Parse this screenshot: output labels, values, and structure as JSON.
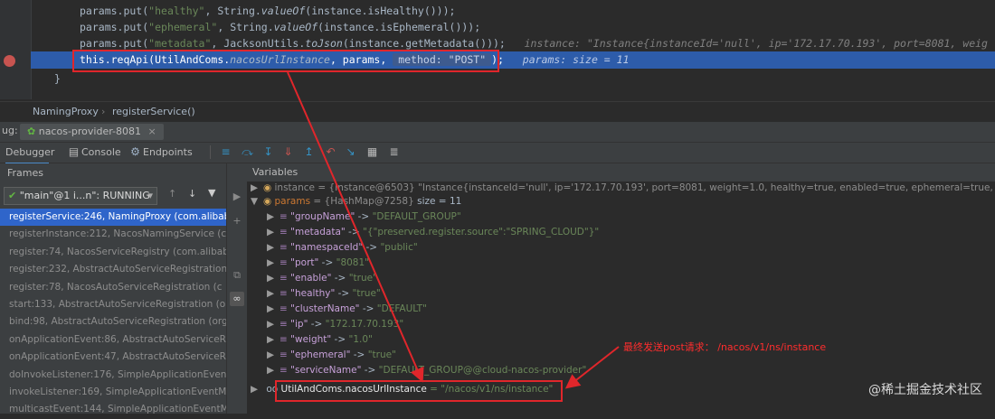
{
  "editor": {
    "lines": [
      {
        "pre": "params.put(",
        "key": "\"healthy\"",
        "mid": ", String.",
        "fn": "valueOf",
        "post": "(instance.isHealthy()));"
      },
      {
        "pre": "params.put(",
        "key": "\"ephemeral\"",
        "mid": ", String.",
        "fn": "valueOf",
        "post": "(instance.isEphemeral()));"
      },
      {
        "pre": "params.put(",
        "key": "\"metadata\"",
        "mid": ", JacksonUtils.",
        "fn": "toJson",
        "post": "(instance.getMetadata()));",
        "inline": "instance: \"Instance{instanceId='null', ip='172.17.70.193', port=8081, weig"
      }
    ],
    "highlight": {
      "code": "this.reqApi(UtilAndComs.",
      "field": "nacosUrlInstance",
      "rest": ", params,",
      "hint_label": "method:",
      "hint_value": "\"POST\"",
      "close": ");",
      "inline": "params:  size = 11"
    },
    "closing_brace": "}"
  },
  "breadcrumb": {
    "class_name": "NamingProxy",
    "method": "registerService()"
  },
  "debug": {
    "label": "ug:",
    "run_tab": "nacos-provider-8081",
    "tabs": {
      "debugger": "Debugger",
      "console": "Console",
      "endpoints": "Endpoints"
    }
  },
  "frames": {
    "header": "Frames",
    "thread": "\"main\"@1 i...n\": RUNNING",
    "items": [
      "registerService:246, NamingProxy (com.alibaba",
      "registerInstance:212, NacosNamingService (c",
      "register:74, NacosServiceRegistry (com.alibaba",
      "register:232, AbstractAutoServiceRegistration",
      "register:78, NacosAutoServiceRegistration (c",
      "start:133, AbstractAutoServiceRegistration (or",
      "bind:98, AbstractAutoServiceRegistration (org",
      "onApplicationEvent:86, AbstractAutoServiceRe",
      "onApplicationEvent:47, AbstractAutoServiceRe",
      "doInvokeListener:176, SimpleApplicationEvent",
      "invokeListener:169, SimpleApplicationEventMu",
      "multicastEvent:144, SimpleApplicationEventMu"
    ]
  },
  "variables": {
    "header": "Variables",
    "instance_row": "instance = {Instance@6503} \"Instance{instanceId='null', ip='172.17.70.193', port=8081, weight=1.0, healthy=true, enabled=true, ephemeral=true, clusterNa",
    "params": {
      "name": "params",
      "type": "= {HashMap@7258}",
      "size": "size = 11"
    },
    "entries": [
      {
        "key": "\"groupName\"",
        "value": "\"DEFAULT_GROUP\""
      },
      {
        "key": "\"metadata\"",
        "value": "\"{\"preserved.register.source\":\"SPRING_CLOUD\"}\""
      },
      {
        "key": "\"namespaceId\"",
        "value": "\"public\""
      },
      {
        "key": "\"port\"",
        "value": "\"8081\""
      },
      {
        "key": "\"enable\"",
        "value": "\"true\""
      },
      {
        "key": "\"healthy\"",
        "value": "\"true\""
      },
      {
        "key": "\"clusterName\"",
        "value": "\"DEFAULT\""
      },
      {
        "key": "\"ip\"",
        "value": "\"172.17.70.193\""
      },
      {
        "key": "\"weight\"",
        "value": "\"1.0\""
      },
      {
        "key": "\"ephemeral\"",
        "value": "\"true\""
      },
      {
        "key": "\"serviceName\"",
        "value": "\"DEFAULT_GROUP@@cloud-nacos-provider\""
      }
    ],
    "url_row": {
      "prefix": "oo",
      "name": "UtilAndComs.nacosUrlInstance",
      "value": "= \"/nacos/v1/ns/instance\""
    }
  },
  "annotation": "最终发送post请求： /nacos/v1/ns/instance",
  "watermark": "@稀土掘金技术社区",
  "colors": {
    "annotation": "#e0262b",
    "selection": "#2f65ca",
    "highlight_line": "#2d5caa"
  }
}
